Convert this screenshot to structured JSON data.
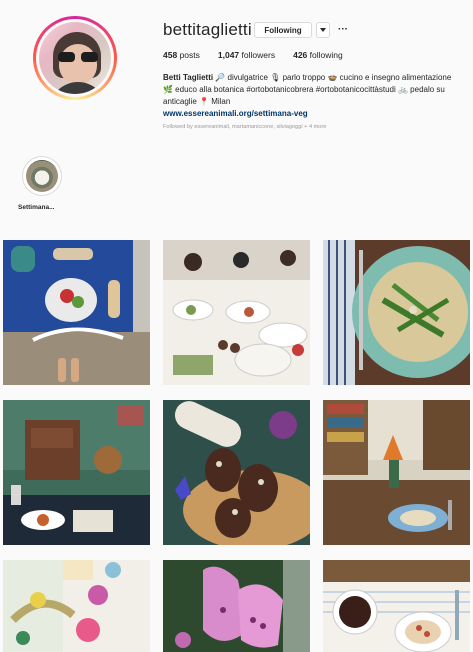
{
  "profile": {
    "username": "bettitaglietti",
    "following_label": "Following",
    "more_label": "···",
    "posts_count": "458",
    "posts_label": "posts",
    "followers_count": "1,047",
    "followers_label": "followers",
    "following_count": "426",
    "following_text": "following"
  },
  "bio": {
    "name": "Betti Taglietti",
    "line1": "🔎 divulgatrice 🎙 parlo troppo 🍲 cucino e insegno alimentazione",
    "line2": "🌿 educo alla botanica #ortobotanicobrera #ortobotanicocittàstudi 🚲 pedalo su",
    "line3": "anticaglie 📍 Milan",
    "link": "www.essereanimali.org/settimana-veg",
    "followed_by": "Followed by essereanimali, martamaniccone, silviagoggi + 4 more"
  },
  "highlights": [
    {
      "label": "Settimana..."
    }
  ],
  "grid_posts": [
    {
      "name": "post-table-blue-cloth"
    },
    {
      "name": "post-dinner-party"
    },
    {
      "name": "post-asparagus-plate"
    },
    {
      "name": "post-kitchen-room"
    },
    {
      "name": "post-chocolate-salami"
    },
    {
      "name": "post-bookshelf-table"
    },
    {
      "name": "post-flowers-watercolor"
    },
    {
      "name": "post-foxglove"
    },
    {
      "name": "post-breakfast-table"
    }
  ],
  "colors": {
    "background": "#fafafa",
    "link": "#003569",
    "muted": "#999999"
  }
}
